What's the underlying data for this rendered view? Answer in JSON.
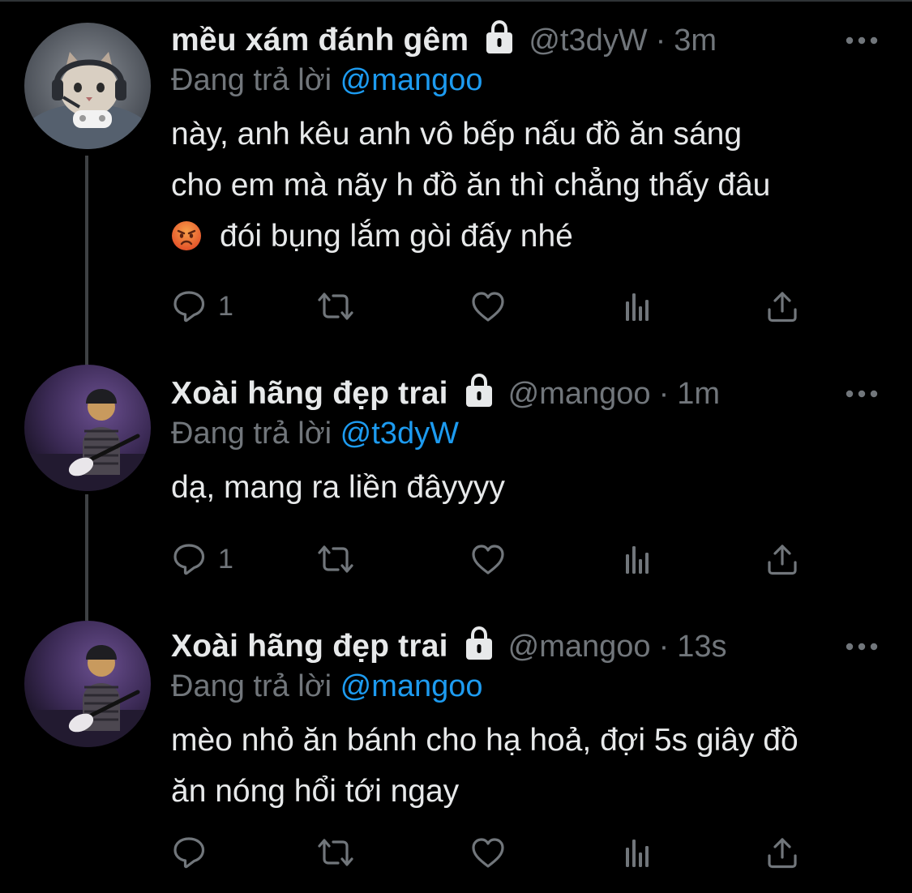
{
  "tweets": [
    {
      "display_name": "mều xám đánh gêm",
      "handle": "@t3dyW",
      "separator": "·",
      "time": "3m",
      "reply_prefix": "Đang trả lời",
      "reply_to": "@mangoo",
      "text_line1": "này, anh kêu anh vô bếp nấu đồ ăn sáng",
      "text_line2": "cho em mà nãy h đồ ăn thì chẳng thấy đâu",
      "emoji": "angry-face",
      "text_line3": "đói bụng lắm gòi đấy nhé",
      "reply_count": "1",
      "avatar": "grey cat with gaming headset and controller",
      "protected": true
    },
    {
      "display_name": "Xoài hãng đẹp trai",
      "handle": "@mangoo",
      "separator": "·",
      "time": "1m",
      "reply_prefix": "Đang trả lời",
      "reply_to": "@t3dyW",
      "text_line1": "dạ, mang ra liền đâyyyy",
      "reply_count": "1",
      "avatar": "dog in beanie playing guitar, purple room",
      "protected": true
    },
    {
      "display_name": "Xoài hãng đẹp trai",
      "handle": "@mangoo",
      "separator": "·",
      "time": "13s",
      "reply_prefix": "Đang trả lời",
      "reply_to": "@mangoo",
      "text_line1": "mèo nhỏ ăn bánh cho hạ hoả, đợi 5s giây đồ",
      "text_line2": "ăn nóng hổi tới ngay",
      "reply_count": "",
      "avatar": "dog in beanie playing guitar, purple room",
      "protected": true
    }
  ],
  "icons": {
    "reply": "reply-bubble-icon",
    "retweet": "retweet-icon",
    "like": "heart-icon",
    "views": "analytics-icon",
    "share": "share-icon",
    "more": "more-dots-icon",
    "lock": "lock-icon"
  },
  "colors": {
    "background": "#000000",
    "text": "#e7e9ea",
    "secondary": "#71767b",
    "link": "#1d9bf0",
    "thread_line": "#3e4144"
  }
}
